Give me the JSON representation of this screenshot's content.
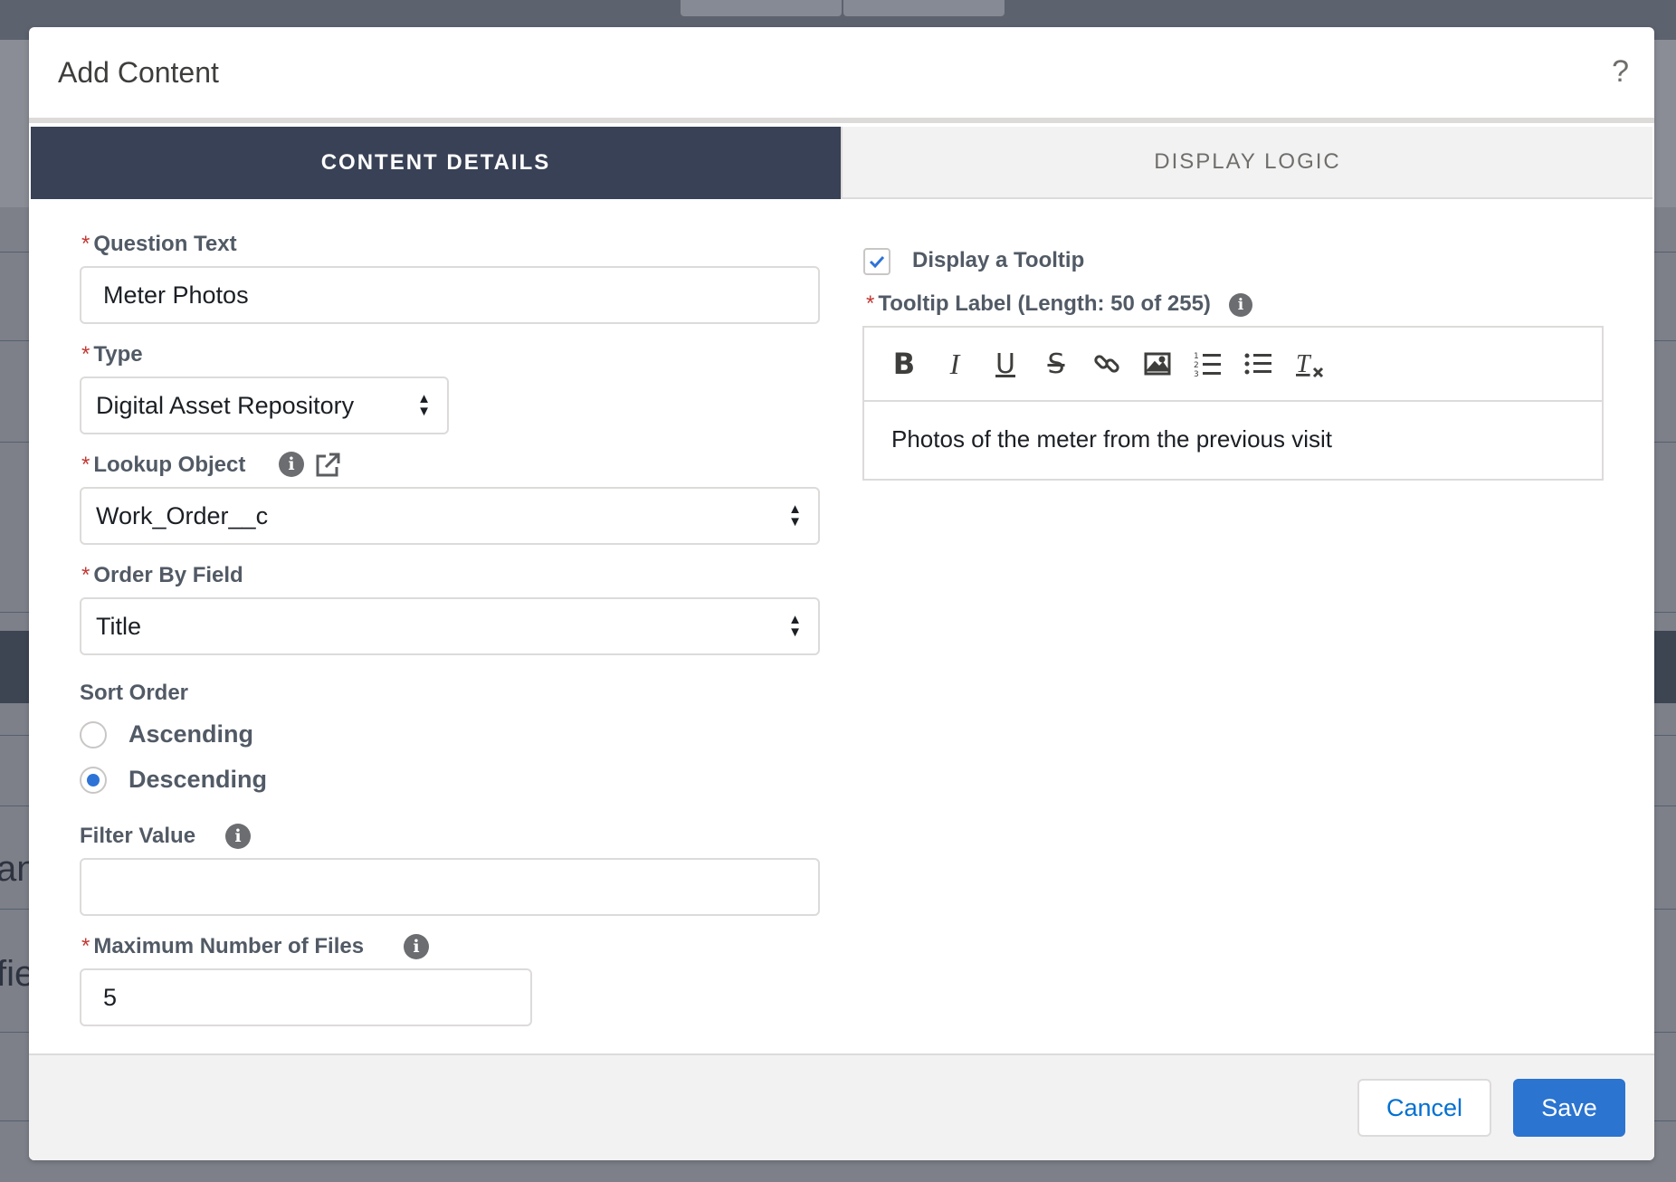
{
  "background": {
    "fragment_1": "ani",
    "fragment_2": "fie"
  },
  "modal": {
    "title": "Add Content",
    "help_icon": "question-mark-icon"
  },
  "tabs": [
    {
      "label": "CONTENT DETAILS",
      "active": true
    },
    {
      "label": "DISPLAY LOGIC",
      "active": false
    }
  ],
  "form": {
    "question_text": {
      "label": "Question Text",
      "required": true,
      "value": "Meter Photos"
    },
    "type": {
      "label": "Type",
      "required": true,
      "value": "Digital Asset Repository"
    },
    "lookup_object": {
      "label": "Lookup Object",
      "required": true,
      "value": "Work_Order__c"
    },
    "order_by_field": {
      "label": "Order By Field",
      "required": true,
      "value": "Title"
    },
    "sort_order": {
      "label": "Sort Order",
      "options": [
        {
          "label": "Ascending",
          "selected": false
        },
        {
          "label": "Descending",
          "selected": true
        }
      ]
    },
    "filter_value": {
      "label": "Filter Value",
      "value": ""
    },
    "max_files": {
      "label": "Maximum Number of Files",
      "required": true,
      "value": "5"
    }
  },
  "tooltip": {
    "display_label": "Display a Tooltip",
    "checked": true,
    "label_text": "Tooltip Label (Length: 50 of 255)",
    "toolbar": [
      "bold-icon",
      "italic-icon",
      "underline-icon",
      "strikethrough-icon",
      "link-icon",
      "image-icon",
      "numbered-list-icon",
      "bulleted-list-icon",
      "clear-format-icon"
    ],
    "content": "Photos of the meter from the previous visit"
  },
  "footer": {
    "cancel_label": "Cancel",
    "save_label": "Save"
  },
  "colors": {
    "active_tab": "#384155",
    "primary_button": "#2b74d0",
    "required": "#c23934",
    "radio_selected": "#2d73d6"
  }
}
